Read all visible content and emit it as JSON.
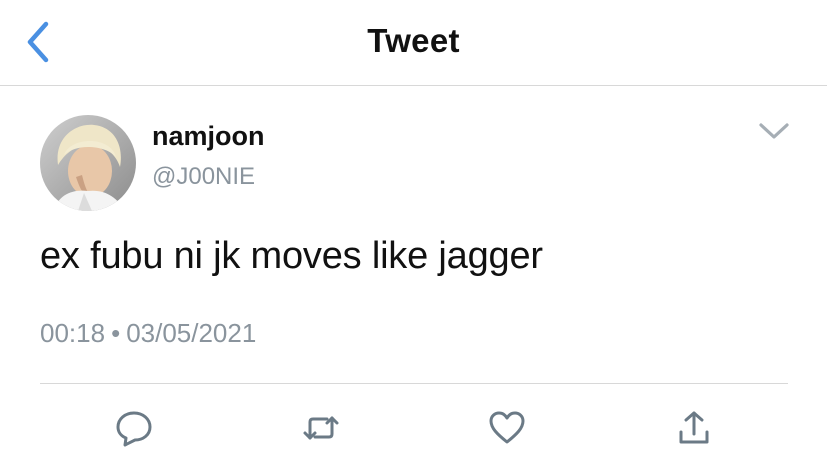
{
  "header": {
    "back_icon": "chevron-left-icon",
    "title": "Tweet"
  },
  "tweet": {
    "author": {
      "display_name": "namjoon",
      "handle": "@J00NIE"
    },
    "caret_icon": "chevron-down-icon",
    "text": "ex fubu ni jk moves like jagger",
    "time": "00:18",
    "separator": "•",
    "date": "03/05/2021"
  },
  "actions": [
    {
      "icon": "reply-icon"
    },
    {
      "icon": "retweet-icon"
    },
    {
      "icon": "like-heart-icon"
    },
    {
      "icon": "share-icon"
    }
  ],
  "colors": {
    "accent": "#4a90e2",
    "text": "#111111",
    "secondary": "#8a949d",
    "icon": "#6b7a86",
    "divider": "#d8d8d8"
  }
}
